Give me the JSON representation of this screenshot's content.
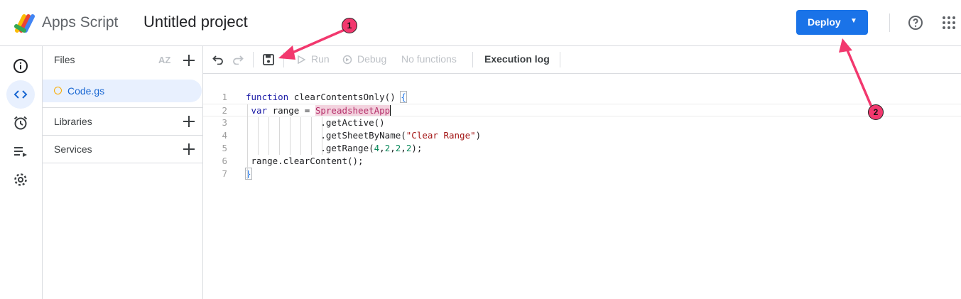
{
  "header": {
    "app_name": "Apps Script",
    "project_title": "Untitled project",
    "deploy_label": "Deploy"
  },
  "rail": {
    "items": [
      "overview-icon",
      "editor-icon",
      "triggers-icon",
      "executions-icon",
      "settings-icon"
    ],
    "active": "editor-icon"
  },
  "files": {
    "title": "Files",
    "sort_label": "AZ",
    "file_name": "Code.gs",
    "libraries_label": "Libraries",
    "services_label": "Services"
  },
  "toolbar": {
    "run_label": "Run",
    "debug_label": "Debug",
    "function_select": "No functions",
    "execution_log_label": "Execution log"
  },
  "editor": {
    "line_numbers": [
      "1",
      "2",
      "3",
      "4",
      "5",
      "6",
      "7"
    ],
    "lines": [
      "function clearContentsOnly() {",
      " var range = SpreadsheetApp",
      "              .getActive()",
      "              .getSheetByName(\"Clear Range\")",
      "              .getRange(4,2,2,2);",
      " range.clearContent();",
      "}"
    ]
  },
  "annotations": {
    "marker_1": "1",
    "marker_2": "2"
  },
  "colors": {
    "accent": "#1a73e8",
    "marker": "#f2386e",
    "file_dot": "#f9ab00"
  }
}
